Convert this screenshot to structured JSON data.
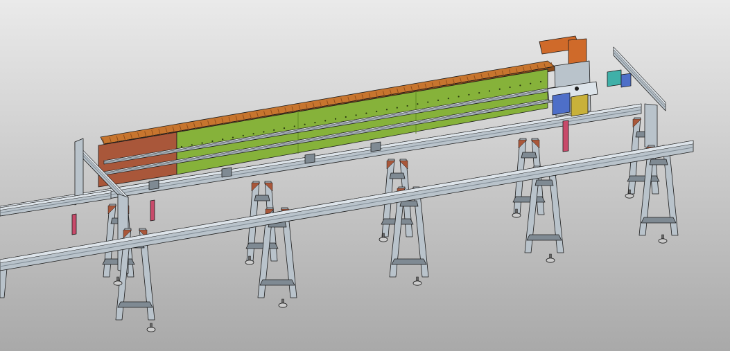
{
  "scene": {
    "subject": "gantry-conveyor-cad-model",
    "colors": {
      "background_top": "#eaeaea",
      "background_bottom": "#a9a9a9",
      "aluminum": "#b9c3cb",
      "aluminum_dark": "#7f8a93",
      "aluminum_light": "#dde4ea",
      "edge": "#1c1c1c",
      "cable_chain": "#c7752e",
      "cable_chain_dark": "#8a4a1a",
      "rail_plate": "#86b23a",
      "rail_plate_dark": "#5f8a23",
      "bracket": "#a9573a",
      "guide_rail": "#cfd8de",
      "stopper": "#c84a6a",
      "carriage_blue": "#4e6fc8",
      "carriage_yellow": "#c8b13a",
      "carriage_teal": "#3fb0a8",
      "motor_orange": "#cf6a2a",
      "leveling_foot": "#cccccc"
    },
    "icons": [
      "leveling-foot-icon",
      "cable-chain-link-icon"
    ]
  }
}
